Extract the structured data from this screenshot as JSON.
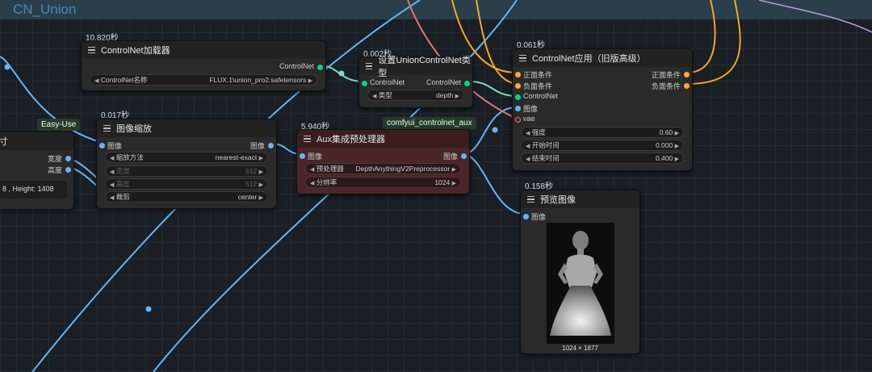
{
  "group": {
    "title": "CN_Union"
  },
  "tags": {
    "easy_use": "Easy-Use",
    "controlnet_aux": "comfyui_controlnet_aux"
  },
  "left_node": {
    "title_partial": "寸",
    "outputs": [
      "宽度",
      "高度"
    ],
    "info": "8 , Height: 1408"
  },
  "controlnet_loader": {
    "timing": "10.820秒",
    "title": "ControlNet加载器",
    "output": "ControlNet",
    "widget": {
      "label": "ControlNet名称",
      "value": "FLUX.1\\union_pro2.safetensors"
    }
  },
  "set_union_type": {
    "timing": "0.002秒",
    "title": "设置UnionControlNet类型",
    "input": "ControlNet",
    "output": "ControlNet",
    "widget": {
      "label": "类型",
      "value": "depth"
    }
  },
  "image_scale": {
    "timing": "0.017秒",
    "title": "图像缩放",
    "input": "图像",
    "output": "图像",
    "widgets": [
      {
        "label": "缩放方法",
        "value": "nearest-exact"
      },
      {
        "label": "宽度",
        "value": "512"
      },
      {
        "label": "高度",
        "value": "512"
      },
      {
        "label": "裁剪",
        "value": "center"
      }
    ]
  },
  "aux_preprocessor": {
    "timing": "5.940秒",
    "title": "Aux集成预处理器",
    "input": "图像",
    "output": "图像",
    "widgets": [
      {
        "label": "预处理器",
        "value": "DepthAnythingV2Preprocessor"
      },
      {
        "label": "分辨率",
        "value": "1024"
      }
    ]
  },
  "controlnet_apply": {
    "timing": "0.061秒",
    "title": "ControlNet应用（旧版高级）",
    "inputs": [
      "正面条件",
      "负面条件",
      "ControlNet",
      "图像",
      "vae"
    ],
    "outputs": [
      "正面条件",
      "负面条件"
    ],
    "widgets": [
      {
        "label": "强度",
        "value": "0.60"
      },
      {
        "label": "开始时间",
        "value": "0.000"
      },
      {
        "label": "结束时间",
        "value": "0.400"
      }
    ]
  },
  "preview_image": {
    "timing": "0.158秒",
    "title": "预览图像",
    "input": "图像",
    "dimensions": "1024 × 1877"
  },
  "colors": {
    "image_socket": "#64b5f6",
    "controlnet_socket": "#00d78d",
    "conditioning_socket": "#ffa931",
    "vae_socket": "#ff6e6e"
  }
}
